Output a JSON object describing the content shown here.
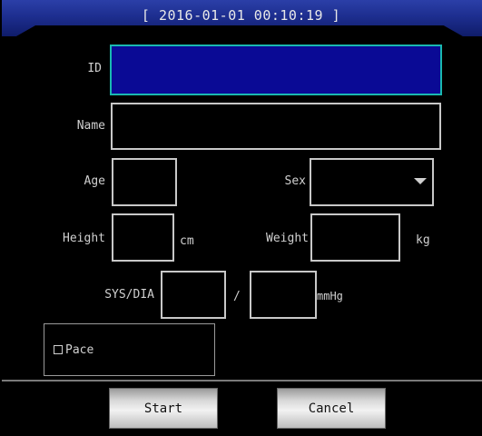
{
  "title": "[ 2016-01-01 00:10:19 ]",
  "form": {
    "id_label": "ID",
    "name_label": "Name",
    "age_label": "Age",
    "sex_label": "Sex",
    "height_label": "Height",
    "height_unit": "cm",
    "weight_label": "Weight",
    "weight_unit": "kg",
    "sysdia_label": "SYS/DIA",
    "sysdia_separator": "/",
    "sysdia_unit": "mmHg",
    "pace_label": "Pace",
    "id_value": "",
    "name_value": "",
    "age_value": "",
    "sex_value": "",
    "height_value": "",
    "weight_value": "",
    "sys_value": "",
    "dia_value": ""
  },
  "buttons": {
    "start": "Start",
    "cancel": "Cancel"
  },
  "colors": {
    "title_bar": "#1d2e8f",
    "focused_field_bg": "#0a0a95",
    "focused_field_border": "#19b8b0"
  }
}
